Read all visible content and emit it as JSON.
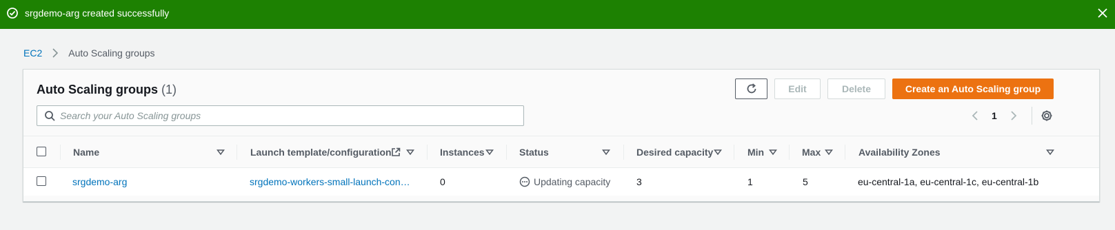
{
  "flash": {
    "message": "srgdemo-arg created successfully",
    "icon": "check-circle-icon",
    "color": "#1d8102"
  },
  "breadcrumb": {
    "root": "EC2",
    "current": "Auto Scaling groups"
  },
  "panel": {
    "title": "Auto Scaling groups",
    "count": "(1)",
    "buttons": {
      "edit": "Edit",
      "delete": "Delete",
      "create": "Create an Auto Scaling group"
    },
    "search_placeholder": "Search your Auto Scaling groups",
    "page": "1",
    "accent": "#ec7211"
  },
  "table": {
    "columns": {
      "name": "Name",
      "launch_template": "Launch template/configuration",
      "instances": "Instances",
      "status": "Status",
      "desired": "Desired capacity",
      "min": "Min",
      "max": "Max",
      "zones": "Availability Zones"
    },
    "rows": [
      {
        "name": "srgdemo-arg",
        "launch_template": "srgdemo-workers-small-launch-con…",
        "instances": "0",
        "status": "Updating capacity",
        "desired": "3",
        "min": "1",
        "max": "5",
        "zones": "eu-central-1a, eu-central-1c, eu-central-1b"
      }
    ]
  }
}
